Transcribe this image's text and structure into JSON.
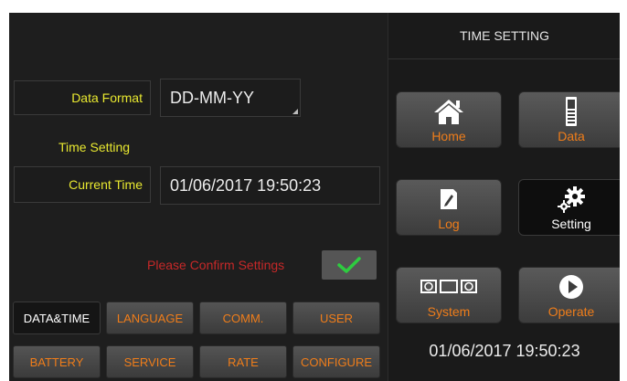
{
  "settings": {
    "data_format_label": "Data Format",
    "data_format_value": "DD-MM-YY",
    "time_heading": "Time Setting",
    "current_time_label": "Current Time",
    "current_time_value": "01/06/2017 19:50:23",
    "confirm_text": "Please Confirm Settings"
  },
  "tabs_row1": [
    "DATA&TIME",
    "LANGUAGE",
    "COMM.",
    "USER"
  ],
  "tabs_row2": [
    "BATTERY",
    "SERVICE",
    "RATE",
    "CONFIGURE"
  ],
  "active_tab": "DATA&TIME",
  "right_panel": {
    "title": "TIME SETTING",
    "buttons": {
      "home": "Home",
      "data": "Data",
      "log": "Log",
      "setting": "Setting",
      "system": "System",
      "operate": "Operate"
    },
    "clock": "01/06/2017 19:50:23"
  },
  "colors": {
    "accent_orange": "#ef7d1a",
    "label_yellow": "#e8e830",
    "confirm_red": "#c62828",
    "check_green": "#2ecc40"
  },
  "icons": {
    "home": "home-icon",
    "data": "battery-icon",
    "log": "log-edit-icon",
    "setting": "gears-icon",
    "system": "system-modules-icon",
    "operate": "play-icon",
    "confirm": "checkmark-icon"
  }
}
